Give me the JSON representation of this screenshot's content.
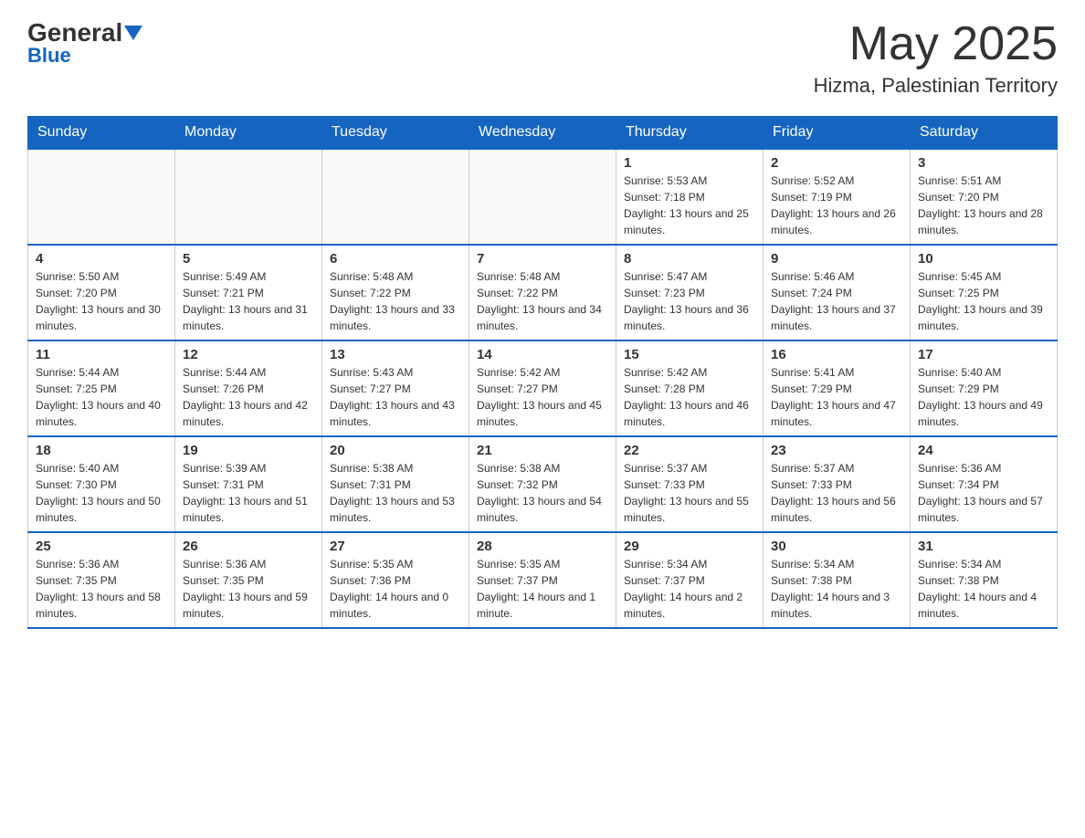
{
  "header": {
    "logo_general": "General",
    "logo_blue": "Blue",
    "month_title": "May 2025",
    "location": "Hizma, Palestinian Territory"
  },
  "weekdays": [
    "Sunday",
    "Monday",
    "Tuesday",
    "Wednesday",
    "Thursday",
    "Friday",
    "Saturday"
  ],
  "weeks": [
    [
      {
        "day": "",
        "info": ""
      },
      {
        "day": "",
        "info": ""
      },
      {
        "day": "",
        "info": ""
      },
      {
        "day": "",
        "info": ""
      },
      {
        "day": "1",
        "info": "Sunrise: 5:53 AM\nSunset: 7:18 PM\nDaylight: 13 hours and 25 minutes."
      },
      {
        "day": "2",
        "info": "Sunrise: 5:52 AM\nSunset: 7:19 PM\nDaylight: 13 hours and 26 minutes."
      },
      {
        "day": "3",
        "info": "Sunrise: 5:51 AM\nSunset: 7:20 PM\nDaylight: 13 hours and 28 minutes."
      }
    ],
    [
      {
        "day": "4",
        "info": "Sunrise: 5:50 AM\nSunset: 7:20 PM\nDaylight: 13 hours and 30 minutes."
      },
      {
        "day": "5",
        "info": "Sunrise: 5:49 AM\nSunset: 7:21 PM\nDaylight: 13 hours and 31 minutes."
      },
      {
        "day": "6",
        "info": "Sunrise: 5:48 AM\nSunset: 7:22 PM\nDaylight: 13 hours and 33 minutes."
      },
      {
        "day": "7",
        "info": "Sunrise: 5:48 AM\nSunset: 7:22 PM\nDaylight: 13 hours and 34 minutes."
      },
      {
        "day": "8",
        "info": "Sunrise: 5:47 AM\nSunset: 7:23 PM\nDaylight: 13 hours and 36 minutes."
      },
      {
        "day": "9",
        "info": "Sunrise: 5:46 AM\nSunset: 7:24 PM\nDaylight: 13 hours and 37 minutes."
      },
      {
        "day": "10",
        "info": "Sunrise: 5:45 AM\nSunset: 7:25 PM\nDaylight: 13 hours and 39 minutes."
      }
    ],
    [
      {
        "day": "11",
        "info": "Sunrise: 5:44 AM\nSunset: 7:25 PM\nDaylight: 13 hours and 40 minutes."
      },
      {
        "day": "12",
        "info": "Sunrise: 5:44 AM\nSunset: 7:26 PM\nDaylight: 13 hours and 42 minutes."
      },
      {
        "day": "13",
        "info": "Sunrise: 5:43 AM\nSunset: 7:27 PM\nDaylight: 13 hours and 43 minutes."
      },
      {
        "day": "14",
        "info": "Sunrise: 5:42 AM\nSunset: 7:27 PM\nDaylight: 13 hours and 45 minutes."
      },
      {
        "day": "15",
        "info": "Sunrise: 5:42 AM\nSunset: 7:28 PM\nDaylight: 13 hours and 46 minutes."
      },
      {
        "day": "16",
        "info": "Sunrise: 5:41 AM\nSunset: 7:29 PM\nDaylight: 13 hours and 47 minutes."
      },
      {
        "day": "17",
        "info": "Sunrise: 5:40 AM\nSunset: 7:29 PM\nDaylight: 13 hours and 49 minutes."
      }
    ],
    [
      {
        "day": "18",
        "info": "Sunrise: 5:40 AM\nSunset: 7:30 PM\nDaylight: 13 hours and 50 minutes."
      },
      {
        "day": "19",
        "info": "Sunrise: 5:39 AM\nSunset: 7:31 PM\nDaylight: 13 hours and 51 minutes."
      },
      {
        "day": "20",
        "info": "Sunrise: 5:38 AM\nSunset: 7:31 PM\nDaylight: 13 hours and 53 minutes."
      },
      {
        "day": "21",
        "info": "Sunrise: 5:38 AM\nSunset: 7:32 PM\nDaylight: 13 hours and 54 minutes."
      },
      {
        "day": "22",
        "info": "Sunrise: 5:37 AM\nSunset: 7:33 PM\nDaylight: 13 hours and 55 minutes."
      },
      {
        "day": "23",
        "info": "Sunrise: 5:37 AM\nSunset: 7:33 PM\nDaylight: 13 hours and 56 minutes."
      },
      {
        "day": "24",
        "info": "Sunrise: 5:36 AM\nSunset: 7:34 PM\nDaylight: 13 hours and 57 minutes."
      }
    ],
    [
      {
        "day": "25",
        "info": "Sunrise: 5:36 AM\nSunset: 7:35 PM\nDaylight: 13 hours and 58 minutes."
      },
      {
        "day": "26",
        "info": "Sunrise: 5:36 AM\nSunset: 7:35 PM\nDaylight: 13 hours and 59 minutes."
      },
      {
        "day": "27",
        "info": "Sunrise: 5:35 AM\nSunset: 7:36 PM\nDaylight: 14 hours and 0 minutes."
      },
      {
        "day": "28",
        "info": "Sunrise: 5:35 AM\nSunset: 7:37 PM\nDaylight: 14 hours and 1 minute."
      },
      {
        "day": "29",
        "info": "Sunrise: 5:34 AM\nSunset: 7:37 PM\nDaylight: 14 hours and 2 minutes."
      },
      {
        "day": "30",
        "info": "Sunrise: 5:34 AM\nSunset: 7:38 PM\nDaylight: 14 hours and 3 minutes."
      },
      {
        "day": "31",
        "info": "Sunrise: 5:34 AM\nSunset: 7:38 PM\nDaylight: 14 hours and 4 minutes."
      }
    ]
  ]
}
